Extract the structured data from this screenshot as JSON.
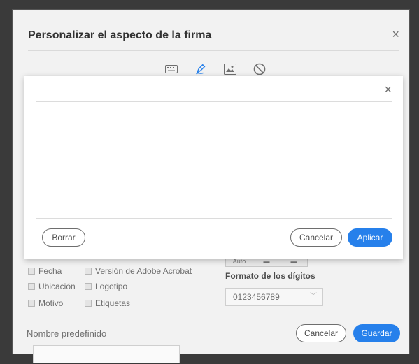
{
  "main_dialog": {
    "title": "Personalizar el aspecto de la firma",
    "close_glyph": "×",
    "mode_icons": [
      "keyboard-icon",
      "pen-draw-icon",
      "image-icon",
      "no-signature-icon"
    ],
    "options": {
      "col1": [
        "Fecha",
        "Ubicación",
        "Motivo"
      ],
      "col2": [
        "Versión de Adobe Acrobat",
        "Logotipo",
        "Etiquetas"
      ]
    },
    "text_direction": {
      "selected_label": "Auto"
    },
    "digits_format": {
      "label": "Formato de los dígitos",
      "value": "0123456789"
    },
    "name": {
      "label": "Nombre predefinido",
      "value": ""
    },
    "buttons": {
      "cancel": "Cancelar",
      "save": "Guardar"
    }
  },
  "draw_dialog": {
    "close_glyph": "×",
    "buttons": {
      "clear": "Borrar",
      "cancel": "Cancelar",
      "apply": "Aplicar"
    }
  },
  "colors": {
    "accent": "#2680eb",
    "dialog_bg": "#f2f2f2",
    "overlay_bg": "#ffffff"
  }
}
